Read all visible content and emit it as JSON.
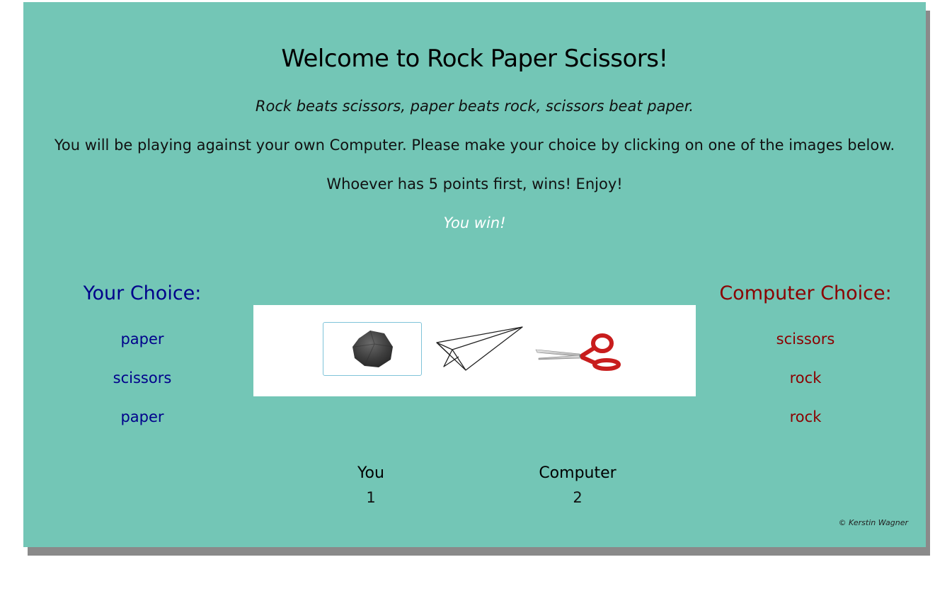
{
  "header": {
    "title": "Welcome to Rock Paper Scissors!",
    "rules": "Rock beats scissors, paper beats rock, scissors beat paper.",
    "intro": "You will be playing against your own Computer. Please make your choice by clicking on one of the images below.",
    "goal": "Whoever has 5 points first, wins! Enjoy!",
    "result": "You win!"
  },
  "player": {
    "heading": "Your Choice:",
    "history": [
      "paper",
      "scissors",
      "paper"
    ]
  },
  "computer": {
    "heading": "Computer Choice:",
    "history": [
      "scissors",
      "rock",
      "rock"
    ]
  },
  "options": [
    {
      "name": "rock",
      "icon": "rock-icon",
      "selected": true
    },
    {
      "name": "paper",
      "icon": "paper-plane-icon",
      "selected": false
    },
    {
      "name": "scissors",
      "icon": "scissors-icon",
      "selected": false
    }
  ],
  "score": {
    "you_label": "You",
    "you_value": "1",
    "computer_label": "Computer",
    "computer_value": "2"
  },
  "footer": {
    "copyright": "© Kerstin Wagner"
  },
  "colors": {
    "background": "#73c6b6",
    "player": "#00008b",
    "computer": "#8b0000",
    "result": "#ffffff"
  }
}
